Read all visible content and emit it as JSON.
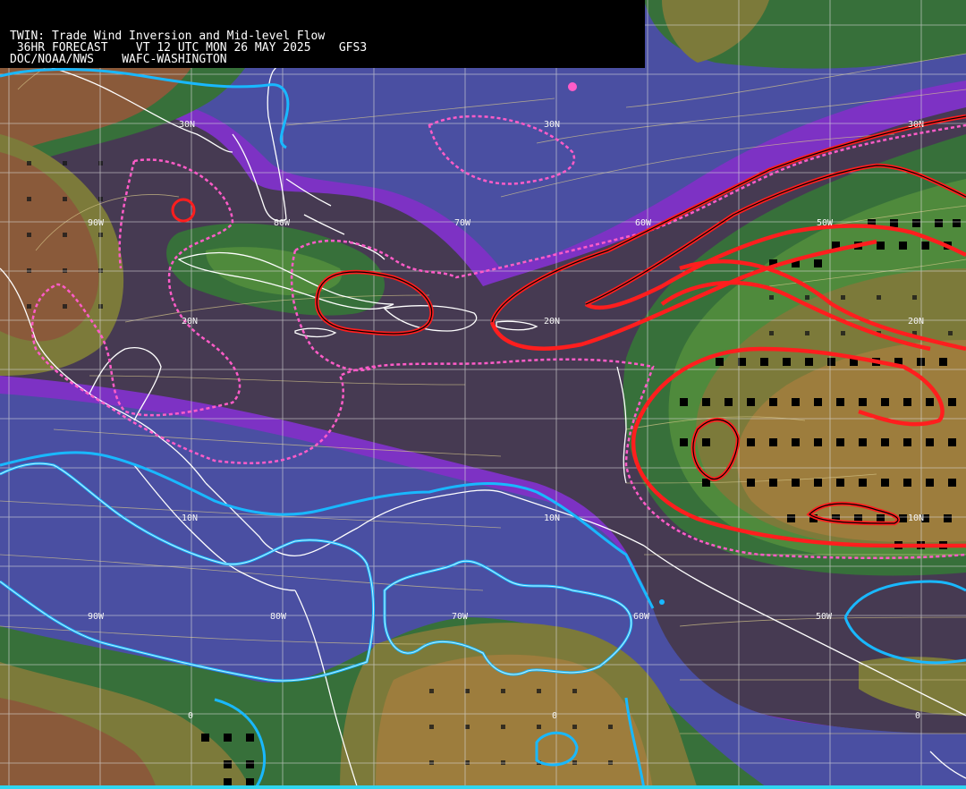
{
  "header": {
    "title": "TWIN: Trade Wind Inversion and Mid-level Flow",
    "forecast_line": " 36HR FORECAST    VT 12 UTC MON 26 MAY 2025    GFS3",
    "agency_line": "DOC/NOAA/NWS    WAFC-WASHINGTON"
  },
  "map_labels": {
    "lat_30n_left": "30N",
    "lon_90w_top": "90W",
    "lon_80w_top": "80W",
    "lon_70w_top": "70W",
    "lon_60w_top": "60W",
    "lon_50w_top": "50W",
    "lat_30n_right": "30N",
    "lat_30n_center": "30N",
    "lat_20n_left": "20N",
    "lat_20n_center": "20N",
    "lat_20n_right": "20N",
    "lat_10n_left": "10N",
    "lat_10n_center": "10N",
    "lat_10n_right": "10N",
    "lon_90w_bottom": "90W",
    "lon_80w_bottom": "80W",
    "lon_70w_bottom": "70W",
    "lon_60w_bottom": "60W",
    "lon_50w_bottom": "50W",
    "lat_0_left": "0",
    "lat_0_center": "0",
    "lat_0_right": "0"
  },
  "colors": {
    "background": "#463a52",
    "purple": "#7d32c4",
    "blue": "#4a4fa2",
    "green_dark": "#37703a",
    "green": "#4f8a3c",
    "olive": "#7c7a3a",
    "tan": "#9d7d3d",
    "brown": "#8a5a3a",
    "grid": "#d9d9d9",
    "coast": "#ffffff",
    "red_contour": "#ff1e1e",
    "pink_dashed": "#ff5cc8",
    "cyan_contour": "#19b8ff",
    "streamline": "#d8c98c"
  }
}
